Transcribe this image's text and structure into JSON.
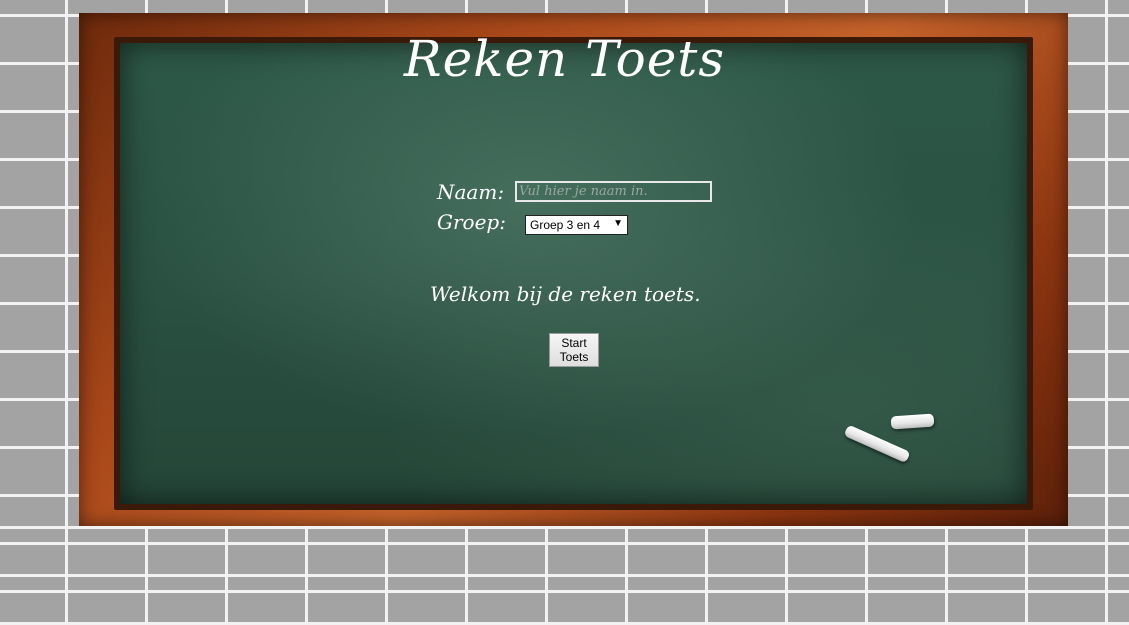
{
  "page": {
    "title": "Reken Toets"
  },
  "form": {
    "name_label": "Naam:",
    "name_placeholder": "Vul hier je naam in.",
    "name_value": "",
    "group_label": "Groep:",
    "group_selected": "Groep 3 en 4"
  },
  "welcome_text": "Welkom bij de reken toets.",
  "start_button_label": "Start\nToets",
  "colors": {
    "board_green": "#2d5847",
    "frame_brown": "#a9481a",
    "wall_gray": "#a3a3a3",
    "chalk_text": "#ffffff"
  },
  "icons": {
    "select_arrow": "dropdown-arrow-icon",
    "chalk": "chalk-pieces-icon"
  }
}
